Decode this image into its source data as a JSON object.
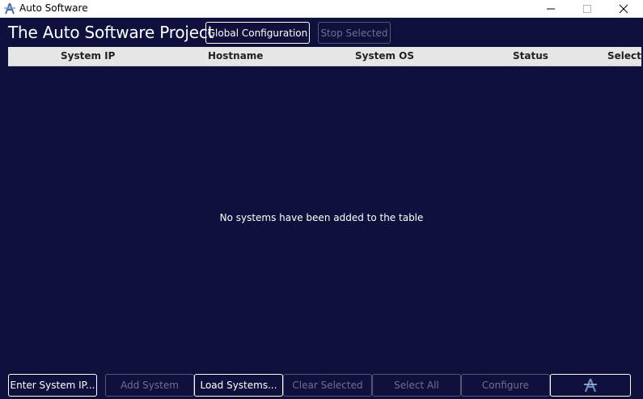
{
  "window": {
    "title": "Auto Software",
    "icon": "app-logo-icon"
  },
  "header": {
    "title": "The Auto Software Project",
    "global_config_label": "Global Configuration",
    "stop_selected_label": "Stop Selected"
  },
  "table": {
    "columns": [
      "System IP",
      "Hostname",
      "System OS",
      "Status",
      "Select"
    ],
    "empty_message": "No systems have been added to the table"
  },
  "footer": {
    "buttons": [
      {
        "label": "Enter System IP...",
        "enabled": true
      },
      {
        "label": "Add System",
        "enabled": false
      },
      {
        "label": "Load Systems...",
        "enabled": true
      },
      {
        "label": "Clear Selected",
        "enabled": false
      },
      {
        "label": "Select All",
        "enabled": false
      },
      {
        "label": "Configure",
        "enabled": false
      }
    ],
    "logo_button_icon": "app-logo-icon"
  },
  "colors": {
    "background": "#10103c",
    "header_row": "#e6e6e6",
    "text": "#ffffff",
    "disabled": "#6f6f8f"
  }
}
